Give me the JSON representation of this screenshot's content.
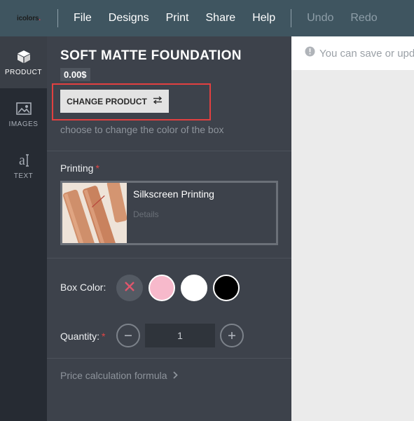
{
  "topbar": {
    "logo": "icolors",
    "menu": [
      "File",
      "Designs",
      "Print",
      "Share",
      "Help"
    ],
    "undo": "Undo",
    "redo": "Redo"
  },
  "rail": {
    "items": [
      {
        "label": "PRODUCT",
        "icon": "box-icon"
      },
      {
        "label": "IMAGES",
        "icon": "image-icon"
      },
      {
        "label": "TEXT",
        "icon": "text-icon"
      }
    ]
  },
  "product": {
    "title": "SOFT MATTE FOUNDATION",
    "price": "0.00$",
    "change_button": "CHANGE PRODUCT",
    "hint": "choose to change the color of the box"
  },
  "printing": {
    "label": "Printing",
    "required_mark": "*",
    "option_name": "Silkscreen Printing",
    "details_link": "Details"
  },
  "box_color": {
    "label": "Box Color:",
    "swatches": [
      "#none",
      "#f7b9cb",
      "#ffffff",
      "#000000"
    ]
  },
  "quantity": {
    "label": "Quantity:",
    "required_mark": "*",
    "value": "1"
  },
  "formula_link": "Price calculation formula",
  "notice": "You can save or upd",
  "colors": {
    "topbar": "#3f5560",
    "panel": "#3d424b",
    "rail": "#262b33",
    "highlight": "#e24040"
  }
}
